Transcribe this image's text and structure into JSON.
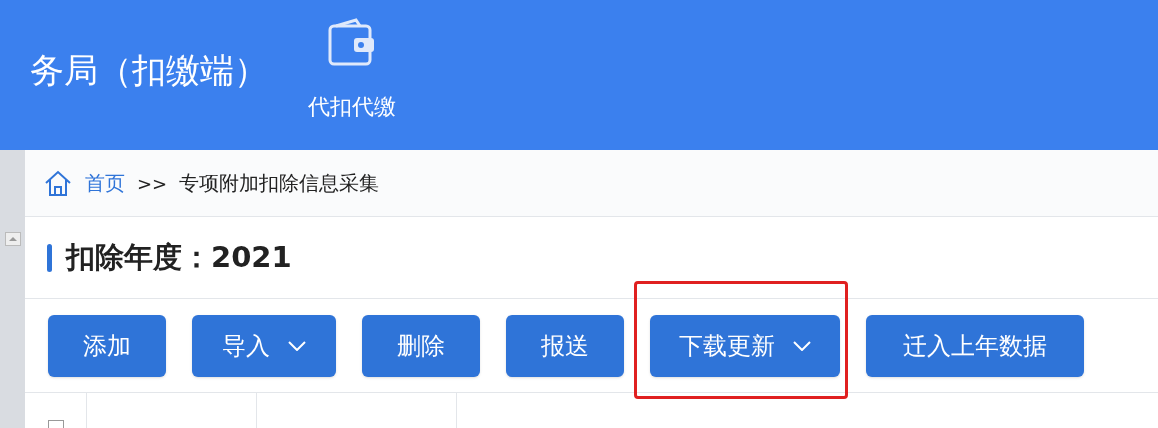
{
  "header": {
    "title": "务局（扣缴端）",
    "nav_items": [
      {
        "label": "代扣代缴"
      }
    ]
  },
  "breadcrumb": {
    "home": "首页",
    "separator": ">>",
    "current": "专项附加扣除信息采集"
  },
  "section": {
    "title": "扣除年度：2021"
  },
  "toolbar": [
    {
      "label": "添加",
      "dropdown": false,
      "highlighted": false
    },
    {
      "label": "导入",
      "dropdown": true,
      "highlighted": false
    },
    {
      "label": "删除",
      "dropdown": false,
      "highlighted": false
    },
    {
      "label": "报送",
      "dropdown": false,
      "highlighted": false
    },
    {
      "label": "下载更新",
      "dropdown": true,
      "highlighted": true
    },
    {
      "label": "迁入上年数据",
      "dropdown": false,
      "highlighted": false
    }
  ],
  "table": {
    "select_all": {
      "checked": false
    }
  }
}
